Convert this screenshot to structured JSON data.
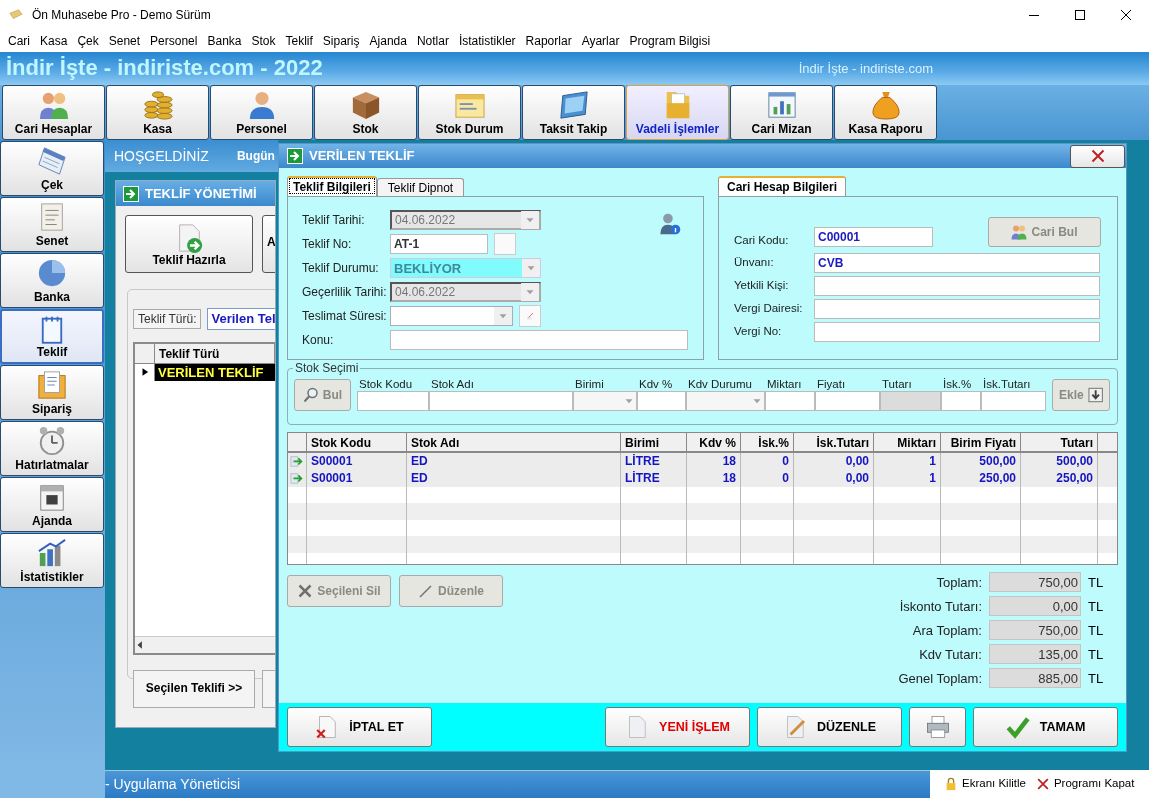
{
  "window": {
    "title": "Ön Muhasebe Pro - Demo Sürüm"
  },
  "menu": [
    "Cari",
    "Kasa",
    "Çek",
    "Senet",
    "Personel",
    "Banka",
    "Stok",
    "Teklif",
    "Sipariş",
    "Ajanda",
    "Notlar",
    "İstatistikler",
    "Raporlar",
    "Ayarlar",
    "Program Bilgisi"
  ],
  "banner": {
    "title": "İndir İşte - indiriste.com - 2022",
    "subtitle": "İndir İşte - indiriste.com"
  },
  "toolbar": [
    {
      "label": "Cari Hesaplar",
      "selected": false
    },
    {
      "label": "Kasa",
      "selected": false
    },
    {
      "label": "Personel",
      "selected": false
    },
    {
      "label": "Stok",
      "selected": false
    },
    {
      "label": "Stok Durum",
      "selected": false
    },
    {
      "label": "Taksit Takip",
      "selected": false
    },
    {
      "label": "Vadeli İşlemler",
      "selected": true
    },
    {
      "label": "Cari Mizan",
      "selected": false
    },
    {
      "label": "Kasa Raporu",
      "selected": false
    }
  ],
  "sidebar": [
    {
      "label": "Çek",
      "selected": false
    },
    {
      "label": "Senet",
      "selected": false
    },
    {
      "label": "Banka",
      "selected": false
    },
    {
      "label": "Teklif",
      "selected": true
    },
    {
      "label": "Sipariş",
      "selected": false
    },
    {
      "label": "Hatırlatmalar",
      "selected": false
    },
    {
      "label": "Ajanda",
      "selected": false
    },
    {
      "label": "İstatistikler",
      "selected": false
    }
  ],
  "welcome": {
    "title": "HOŞGELDİNİZ",
    "date_label": "Bugün"
  },
  "offer_manager": {
    "title": "TEKLİF YÖNETİMİ",
    "buttons": [
      "Teklif Hazırla",
      "A"
    ],
    "filter_label": "Teklif Türü:",
    "filter_value": "Verilen Tel",
    "columns": [
      "Teklif Türü"
    ],
    "rows": [
      {
        "cells": [
          "VERİLEN TEKLİF"
        ],
        "selected": true
      }
    ],
    "footer_button": "Seçilen Teklifi >>"
  },
  "dialog": {
    "title": "VERİLEN TEKLİF",
    "tabs": [
      {
        "label": "Teklif Bilgileri",
        "selected": true
      },
      {
        "label": "Teklif Dipnot",
        "selected": false
      }
    ],
    "offer_fields": [
      {
        "label": "Teklif Tarihi:",
        "kind": "date",
        "value": "04.06.2022"
      },
      {
        "label": "Teklif No:",
        "kind": "code",
        "value": "AT-1"
      },
      {
        "label": "Teklif Durumu:",
        "kind": "status",
        "value": "BEKLİYOR"
      },
      {
        "label": "Geçerlilik Tarihi:",
        "kind": "date",
        "value": "04.06.2022"
      },
      {
        "label": "Teslimat Süresi:",
        "kind": "combo"
      },
      {
        "label": "Konu:",
        "kind": "wide"
      }
    ],
    "account_tab": "Cari Hesap Bilgileri",
    "find_account": {
      "label": "Cari Bul",
      "disabled": true
    },
    "account_fields": [
      {
        "label": "Cari Kodu:",
        "kind": "short",
        "value": "C00001"
      },
      {
        "label": "Ünvanı:",
        "kind": "wide",
        "value": "CVB"
      },
      {
        "label": "Yetkili Kişi:",
        "kind": "wide"
      },
      {
        "label": "Vergi Dairesi:",
        "kind": "wide"
      },
      {
        "label": "Vergi No:",
        "kind": "wide"
      }
    ],
    "stock_selection": {
      "title": "Stok Seçimi",
      "find": {
        "label": "Bul",
        "disabled": true
      },
      "fields": [
        {
          "label": "Stok Kodu",
          "kind": "text"
        },
        {
          "label": "Stok Adı",
          "kind": "text"
        },
        {
          "label": "Birimi",
          "kind": "combo"
        },
        {
          "label": "Kdv %",
          "kind": "text"
        },
        {
          "label": "Kdv Durumu",
          "kind": "combo"
        },
        {
          "label": "Miktarı",
          "kind": "text"
        },
        {
          "label": "Fiyatı",
          "kind": "text"
        },
        {
          "label": "Tutarı",
          "kind": "readonly"
        },
        {
          "label": "İsk.%",
          "kind": "text"
        },
        {
          "label": "İsk.Tutarı",
          "kind": "text"
        }
      ],
      "add": {
        "label": "Ekle",
        "disabled": true
      }
    },
    "items": {
      "columns": [
        {
          "label": "Stok Kodu",
          "numeric": false
        },
        {
          "label": "Stok Adı",
          "numeric": false
        },
        {
          "label": "Birimi",
          "numeric": false
        },
        {
          "label": "Kdv %",
          "numeric": true
        },
        {
          "label": "İsk.%",
          "numeric": true
        },
        {
          "label": "İsk.Tutarı",
          "numeric": true
        },
        {
          "label": "Miktarı",
          "numeric": true
        },
        {
          "label": "Birim Fiyatı",
          "numeric": true
        },
        {
          "label": "Tutarı",
          "numeric": true
        }
      ],
      "rows": [
        {
          "cells": [
            "S00001",
            "ED",
            "LİTRE",
            "18",
            "0",
            "0,00",
            "1",
            "500,00",
            "500,00"
          ]
        },
        {
          "cells": [
            "S00001",
            "ED",
            "LİTRE",
            "18",
            "0",
            "0,00",
            "1",
            "250,00",
            "250,00"
          ]
        }
      ]
    },
    "row_buttons": [
      {
        "label": "Seçileni Sil",
        "kind": "delete",
        "disabled": true
      },
      {
        "label": "Düzenle",
        "kind": "edit",
        "disabled": true
      }
    ],
    "totals": [
      {
        "label": "Toplam:",
        "value": "750,00",
        "unit": "TL"
      },
      {
        "label": "İskonto Tutarı:",
        "value": "0,00",
        "unit": "TL"
      },
      {
        "label": "Ara Toplam:",
        "value": "750,00",
        "unit": "TL"
      },
      {
        "label": "Kdv Tutarı:",
        "value": "135,00",
        "unit": "TL"
      },
      {
        "label": "Genel Toplam:",
        "value": "885,00",
        "unit": "TL"
      }
    ],
    "footer_buttons": [
      {
        "label": "İPTAL ET",
        "kind": "cancel"
      },
      {
        "label": "YENİ İŞLEM",
        "kind": "new"
      },
      {
        "label": "DÜZENLE",
        "kind": "edit"
      },
      {
        "kind": "print"
      },
      {
        "label": "TAMAM",
        "kind": "ok"
      }
    ]
  },
  "status_bar": {
    "user": "- Uygulama Yöneticisi",
    "lock": "Ekranı Kilitle",
    "exit": "Programı Kapat"
  }
}
